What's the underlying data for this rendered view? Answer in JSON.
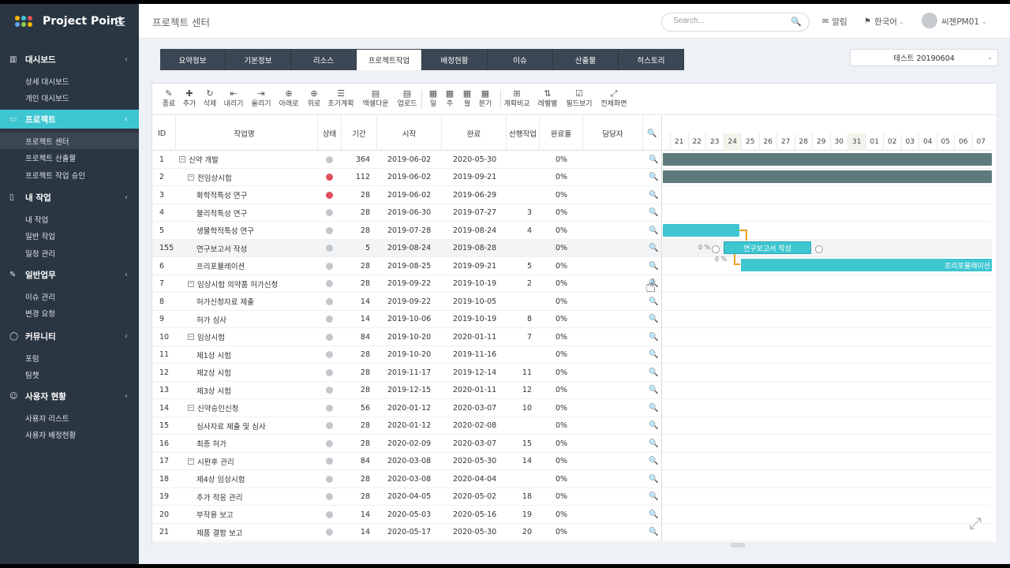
{
  "brand": {
    "name": "Project Point",
    "menu_icon": "hamburger-icon",
    "dot_colors": [
      "#f5b400",
      "#3ec6d1",
      "#e0505e",
      "#5aa9e6",
      "#8ccd4f",
      "#f5b400"
    ]
  },
  "sidebar": {
    "sections": [
      {
        "key": "dashboard",
        "label": "대시보드",
        "icon": "bar-chart-icon",
        "items": [
          "상세 대시보드",
          "개인 대시보드"
        ]
      },
      {
        "key": "project",
        "label": "프로젝트",
        "icon": "monitor-icon",
        "active": true,
        "items": [
          "프로젝트 센터",
          "프로젝트 산출물",
          "프로젝트 작업 승인"
        ],
        "active_item": 0
      },
      {
        "key": "mywork",
        "label": "내 작업",
        "icon": "tablet-icon",
        "items": [
          "내 작업",
          "일반 작업",
          "일정 관리"
        ]
      },
      {
        "key": "general",
        "label": "일반업무",
        "icon": "edit-icon",
        "items": [
          "이슈 관리",
          "변경 요청"
        ]
      },
      {
        "key": "community",
        "label": "커뮤니티",
        "icon": "chat-icon",
        "items": [
          "포럼",
          "팀챗"
        ]
      },
      {
        "key": "users",
        "label": "사용자 현황",
        "icon": "users-icon",
        "items": [
          "사용자 리스트",
          "사용자 배정현황"
        ]
      }
    ]
  },
  "header": {
    "title": "프로젝트 센터",
    "search_placeholder": "Search...",
    "alerts": "알림",
    "language": "한국어",
    "user": "씨젠PM01"
  },
  "tabs": [
    "요약정보",
    "기본정보",
    "리소스",
    "프로젝트작업",
    "배정현황",
    "이슈",
    "산출물",
    "히스토리"
  ],
  "active_tab": 3,
  "project_select": "테스트 20190604",
  "toolbar": [
    {
      "label": "종료",
      "icon": "edit-icon"
    },
    {
      "label": "추가",
      "icon": "plus-icon"
    },
    {
      "label": "삭제",
      "icon": "undo-icon"
    },
    {
      "label": "내리기",
      "icon": "outdent-icon"
    },
    {
      "label": "올리기",
      "icon": "indent-icon"
    },
    {
      "label": "아래로",
      "icon": "arrow-down-icon"
    },
    {
      "label": "위로",
      "icon": "arrow-up-icon"
    },
    {
      "label": "초기계획",
      "icon": "list-icon"
    },
    {
      "label": "엑셀다운",
      "icon": "excel-icon"
    },
    {
      "label": "업로드",
      "icon": "upload-icon"
    },
    {
      "label": "일",
      "icon": "calendar-icon"
    },
    {
      "label": "주",
      "icon": "calendar-icon"
    },
    {
      "label": "월",
      "icon": "calendar-icon"
    },
    {
      "label": "분기",
      "icon": "calendar-icon"
    },
    {
      "label": "계획비교",
      "icon": "grid-icon"
    },
    {
      "label": "레벨별",
      "icon": "sort-icon"
    },
    {
      "label": "필드보기",
      "icon": "checkbox-icon"
    },
    {
      "label": "전체화면",
      "icon": "expand-icon"
    }
  ],
  "columns": [
    "ID",
    "작업명",
    "상태",
    "기간",
    "시작",
    "완료",
    "선행작업",
    "완료율",
    "담당자"
  ],
  "rows": [
    {
      "id": "1",
      "name": "신약 개발",
      "level": 0,
      "toggle": "−",
      "status": "gray",
      "duration": "364",
      "start": "2019-06-02",
      "end": "2020-05-30",
      "pred": "",
      "pct": "0%"
    },
    {
      "id": "2",
      "name": "전임상시험",
      "level": 1,
      "toggle": "−",
      "status": "red",
      "duration": "112",
      "start": "2019-06-02",
      "end": "2019-09-21",
      "pred": "",
      "pct": "0%"
    },
    {
      "id": "3",
      "name": "화학적특성 연구",
      "level": 2,
      "toggle": "",
      "status": "red",
      "duration": "28",
      "start": "2019-06-02",
      "end": "2019-06-29",
      "pred": "",
      "pct": "0%"
    },
    {
      "id": "4",
      "name": "물리적특성 연구",
      "level": 2,
      "toggle": "",
      "status": "gray",
      "duration": "28",
      "start": "2019-06-30",
      "end": "2019-07-27",
      "pred": "3",
      "pct": "0%"
    },
    {
      "id": "5",
      "name": "생물학적특성 연구",
      "level": 2,
      "toggle": "",
      "status": "gray",
      "duration": "28",
      "start": "2019-07-28",
      "end": "2019-08-24",
      "pred": "4",
      "pct": "0%"
    },
    {
      "id": "155",
      "name": "연구보고서 작성",
      "level": 2,
      "toggle": "",
      "status": "gray",
      "duration": "5",
      "start": "2019-08-24",
      "end": "2019-08-28",
      "pred": "",
      "pct": "0%",
      "highlight": true
    },
    {
      "id": "6",
      "name": "프리포뮬레이션",
      "level": 2,
      "toggle": "",
      "status": "gray",
      "duration": "28",
      "start": "2019-08-25",
      "end": "2019-09-21",
      "pred": "5",
      "pct": "0%"
    },
    {
      "id": "7",
      "name": "임상시험 의약품 허가신청",
      "level": 1,
      "toggle": "−",
      "status": "gray",
      "duration": "28",
      "start": "2019-09-22",
      "end": "2019-10-19",
      "pred": "2",
      "pct": "0%"
    },
    {
      "id": "8",
      "name": "허가신청자료 제출",
      "level": 2,
      "toggle": "",
      "status": "gray",
      "duration": "14",
      "start": "2019-09-22",
      "end": "2019-10-05",
      "pred": "",
      "pct": "0%"
    },
    {
      "id": "9",
      "name": "허가 심사",
      "level": 2,
      "toggle": "",
      "status": "gray",
      "duration": "14",
      "start": "2019-10-06",
      "end": "2019-10-19",
      "pred": "8",
      "pct": "0%"
    },
    {
      "id": "10",
      "name": "임상시험",
      "level": 1,
      "toggle": "−",
      "status": "gray",
      "duration": "84",
      "start": "2019-10-20",
      "end": "2020-01-11",
      "pred": "7",
      "pct": "0%"
    },
    {
      "id": "11",
      "name": "제1상 시험",
      "level": 2,
      "toggle": "",
      "status": "gray",
      "duration": "28",
      "start": "2019-10-20",
      "end": "2019-11-16",
      "pred": "",
      "pct": "0%"
    },
    {
      "id": "12",
      "name": "제2상 시험",
      "level": 2,
      "toggle": "",
      "status": "gray",
      "duration": "28",
      "start": "2019-11-17",
      "end": "2019-12-14",
      "pred": "11",
      "pct": "0%"
    },
    {
      "id": "13",
      "name": "제3상 시험",
      "level": 2,
      "toggle": "",
      "status": "gray",
      "duration": "28",
      "start": "2019-12-15",
      "end": "2020-01-11",
      "pred": "12",
      "pct": "0%"
    },
    {
      "id": "14",
      "name": "신약승인신청",
      "level": 1,
      "toggle": "−",
      "status": "gray",
      "duration": "56",
      "start": "2020-01-12",
      "end": "2020-03-07",
      "pred": "10",
      "pct": "0%"
    },
    {
      "id": "15",
      "name": "심사자료 제출 및 심사",
      "level": 2,
      "toggle": "",
      "status": "gray",
      "duration": "28",
      "start": "2020-01-12",
      "end": "2020-02-08",
      "pred": "",
      "pct": "0%"
    },
    {
      "id": "16",
      "name": "최종 허가",
      "level": 2,
      "toggle": "",
      "status": "gray",
      "duration": "28",
      "start": "2020-02-09",
      "end": "2020-03-07",
      "pred": "15",
      "pct": "0%"
    },
    {
      "id": "17",
      "name": "시판후 관리",
      "level": 1,
      "toggle": "−",
      "status": "gray",
      "duration": "84",
      "start": "2020-03-08",
      "end": "2020-05-30",
      "pred": "14",
      "pct": "0%"
    },
    {
      "id": "18",
      "name": "제4상 임상시험",
      "level": 2,
      "toggle": "",
      "status": "gray",
      "duration": "28",
      "start": "2020-03-08",
      "end": "2020-04-04",
      "pred": "",
      "pct": "0%"
    },
    {
      "id": "19",
      "name": "추가 적응 관리",
      "level": 2,
      "toggle": "",
      "status": "gray",
      "duration": "28",
      "start": "2020-04-05",
      "end": "2020-05-02",
      "pred": "18",
      "pct": "0%"
    },
    {
      "id": "20",
      "name": "부작용 보고",
      "level": 2,
      "toggle": "",
      "status": "gray",
      "duration": "14",
      "start": "2020-05-03",
      "end": "2020-05-16",
      "pred": "19",
      "pct": "0%"
    },
    {
      "id": "21",
      "name": "제품 결함 보고",
      "level": 2,
      "toggle": "",
      "status": "gray",
      "duration": "14",
      "start": "2020-05-17",
      "end": "2020-05-30",
      "pred": "20",
      "pct": "0%"
    }
  ],
  "gantt": {
    "days": [
      "",
      "21",
      "22",
      "23",
      "24",
      "25",
      "26",
      "27",
      "28",
      "29",
      "30",
      "31",
      "01",
      "02",
      "03",
      "04",
      "05",
      "06",
      "07"
    ],
    "bar_labels": {
      "report": "연구보고서 작성",
      "prefor": "프리포뮬레이션"
    },
    "pct_labels": [
      "0 %",
      "0 %"
    ],
    "colors": {
      "summary": "#5d7b7d",
      "task": "#3ec6d1",
      "link": "#f0a020"
    }
  }
}
